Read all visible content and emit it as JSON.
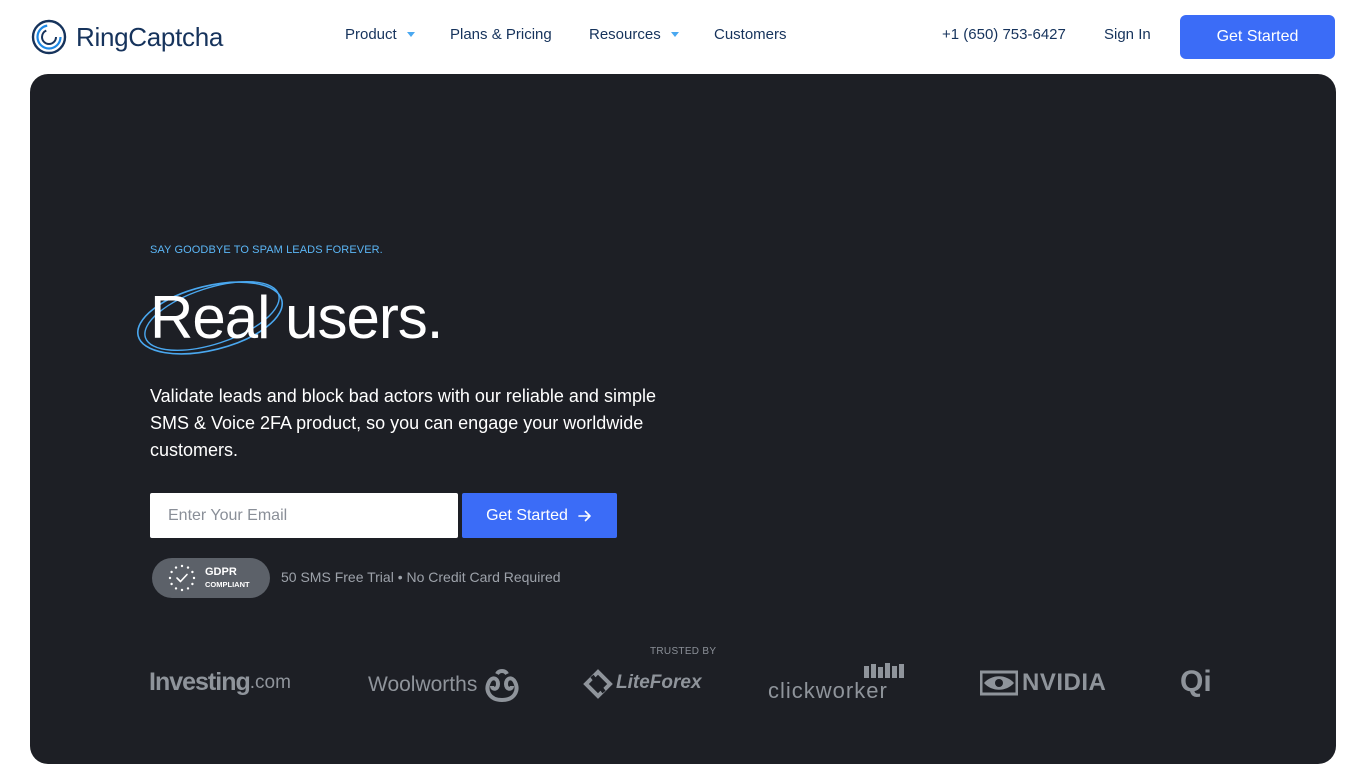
{
  "header": {
    "brand": "RingCaptcha",
    "nav": [
      {
        "label": "Product",
        "dropdown": true
      },
      {
        "label": "Plans & Pricing",
        "dropdown": false
      },
      {
        "label": "Resources",
        "dropdown": true
      },
      {
        "label": "Customers",
        "dropdown": false
      }
    ],
    "phone": "+1 (650) 753-6427",
    "signin": "Sign In",
    "cta": "Get Started"
  },
  "hero": {
    "eyebrow": "SAY GOODBYE TO SPAM LEADS FOREVER.",
    "headline_word1": "Real",
    "headline_word2": "users.",
    "subtext": "Validate leads and block bad actors with our reliable and simple SMS & Voice 2FA product, so you can engage your worldwide customers.",
    "email_placeholder": "Enter Your Email",
    "cta": "Get Started",
    "cta_icon": "arrow-right-icon",
    "gdpr_line1": "GDPR",
    "gdpr_line2": "COMPLIANT",
    "trial_note": "50 SMS Free Trial • No Credit Card Required",
    "trusted_label": "TRUSTED BY",
    "logos": {
      "investing": "Investing",
      "investing_suffix": ".com",
      "woolworths": "Woolworths",
      "liteforex": "LiteForex",
      "clickworker": "clickworker",
      "nvidia": "NVIDIA",
      "qi": "Qi"
    }
  },
  "colors": {
    "brand_navy": "#16335c",
    "accent_blue": "#3b6cf7",
    "hero_bg": "#1d1f25",
    "eyebrow_blue": "#5bb6f6"
  }
}
